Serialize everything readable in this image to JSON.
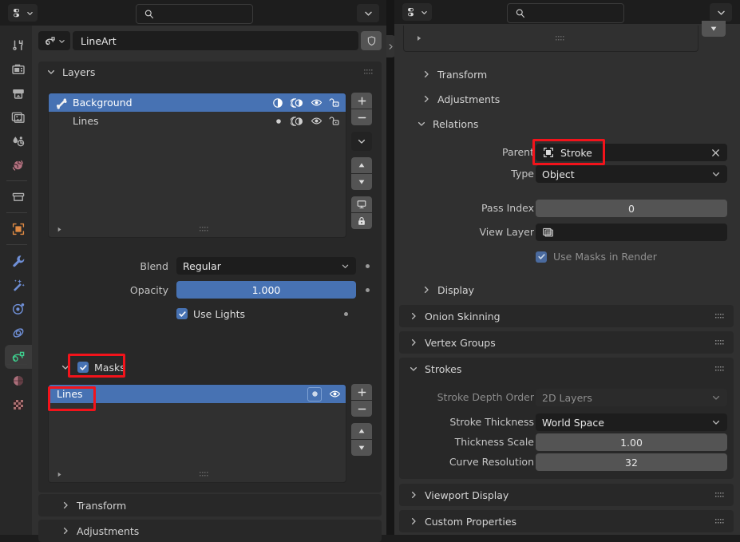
{
  "app": "blender-properties-editor",
  "left_editor": {
    "header": {
      "editor_type_icon": "properties-editor-icon",
      "search_placeholder": "",
      "search_icon": "search-icon",
      "overflow_icon": "chevron-down-icon"
    },
    "breadcrumb": {
      "datablock_icon": "grease-pencil-data-icon",
      "name": "LineArt",
      "shield_icon": "fake-user-shield-icon"
    },
    "layers_panel": {
      "title": "Layers",
      "expanded": true,
      "grip_icon": "drag-grip-icon",
      "rows": [
        {
          "name": "Background",
          "selected": true,
          "mask_icon": "layer-mask-icon",
          "onion_icon": "onion-skin-icon",
          "hide_icon": "eye-icon",
          "lock_icon": "unlocked-icon"
        },
        {
          "name": "Lines",
          "selected": false,
          "mask_icon": "dot-icon",
          "onion_icon": "onion-skin-icon",
          "hide_icon": "eye-icon",
          "lock_icon": "unlocked-icon"
        }
      ],
      "list_footer_expand_icon": "triangle-right-icon",
      "list_footer_grip_icon": "drag-grip-icon",
      "side_buttons": [
        {
          "name": "add-layer-button",
          "icon": "plus-icon"
        },
        {
          "name": "remove-layer-button",
          "icon": "minus-icon"
        },
        {
          "name": "layer-specials-menu-button",
          "icon": "chevron-down-icon"
        },
        {
          "name": "move-layer-up-button",
          "icon": "triangle-up-icon"
        },
        {
          "name": "move-layer-down-button",
          "icon": "triangle-down-icon"
        },
        {
          "name": "isolate-layer-button",
          "icon": "monitor-icon"
        },
        {
          "name": "lock-layer-button",
          "icon": "lock-icon"
        }
      ]
    },
    "properties": {
      "blend": {
        "label": "Blend",
        "value": "Regular",
        "animate_icon": "animate-dot-icon"
      },
      "opacity": {
        "label": "Opacity",
        "value": "1.000",
        "animate_icon": "animate-dot-icon"
      },
      "use_lights": {
        "label": "Use Lights",
        "checked": true,
        "animate_icon": "animate-dot-icon"
      }
    },
    "masks_panel": {
      "title": "Masks",
      "checked": true,
      "expanded": true,
      "highlighted": true,
      "rows": [
        {
          "name": "Lines",
          "selected": true,
          "highlighted": true,
          "invert_icon": "circle-filled-icon",
          "hide_icon": "eye-icon"
        }
      ],
      "list_footer_expand_icon": "triangle-right-icon",
      "list_footer_grip_icon": "drag-grip-icon",
      "side_buttons": [
        {
          "name": "add-mask-button",
          "icon": "plus-icon"
        },
        {
          "name": "remove-mask-button",
          "icon": "minus-icon"
        },
        {
          "name": "move-mask-up-button",
          "icon": "triangle-up-icon"
        },
        {
          "name": "move-mask-down-button",
          "icon": "triangle-down-icon"
        }
      ]
    },
    "bottom_panels": [
      {
        "title": "Transform",
        "expanded": false
      },
      {
        "title": "Adjustments",
        "expanded": false
      }
    ]
  },
  "tab_column": {
    "tabs": [
      {
        "name": "tool-tab",
        "icon": "tool-screwdriver-wrench-icon",
        "active": false
      },
      {
        "name": "render-tab",
        "icon": "camera-back-icon",
        "active": false
      },
      {
        "name": "output-tab",
        "icon": "printer-icon",
        "active": false
      },
      {
        "name": "view-layer-tab",
        "icon": "images-icon",
        "active": false
      },
      {
        "name": "scene-tab",
        "icon": "scene-cone-droplet-icon",
        "active": false
      },
      {
        "name": "world-tab",
        "icon": "world-globe-icon",
        "active": false
      },
      {
        "name": "collection-tab",
        "icon": "collection-box-icon",
        "active": false
      },
      {
        "name": "object-tab",
        "icon": "object-square-icon",
        "active": false
      },
      {
        "name": "modifiers-tab",
        "icon": "wrench-icon",
        "active": false
      },
      {
        "name": "effects-tab",
        "icon": "magic-wand-icon",
        "active": false
      },
      {
        "name": "particles-tab",
        "icon": "particles-icon",
        "active": false
      },
      {
        "name": "physics-tab",
        "icon": "physics-orbit-icon",
        "active": false
      },
      {
        "name": "object-data-tab",
        "icon": "grease-pencil-data-icon",
        "active": true
      },
      {
        "name": "material-tab",
        "icon": "material-sphere-icon",
        "active": false
      },
      {
        "name": "texture-tab",
        "icon": "texture-checker-icon",
        "active": false
      }
    ]
  },
  "right_editor": {
    "header": {
      "editor_type_icon": "properties-editor-icon",
      "search_placeholder": "",
      "search_icon": "search-icon",
      "overflow_icon": "chevron-down-icon"
    },
    "scroll_up_icon": "triangle-down-icon",
    "region_toggle_icon": "chevron-right-icon",
    "list_footer_expand_icon": "triangle-right-icon",
    "list_footer_grip_icon": "drag-grip-icon",
    "panels": [
      {
        "title": "Transform",
        "expanded": false,
        "sub": true
      },
      {
        "title": "Adjustments",
        "expanded": false,
        "sub": true
      },
      {
        "title": "Relations",
        "expanded": true,
        "sub": true
      }
    ],
    "relations": {
      "parent": {
        "label": "Parent",
        "value": "Stroke",
        "object_icon": "object-square-icon",
        "clear_icon": "x-icon",
        "highlighted": true
      },
      "type": {
        "label": "Type",
        "value": "Object"
      },
      "pass_index": {
        "label": "Pass Index",
        "value": "0"
      },
      "view_layer": {
        "label": "View Layer",
        "value": "",
        "icon": "images-icon"
      },
      "use_masks_in_render": {
        "label": "Use Masks in Render",
        "checked": true,
        "disabled": true
      }
    },
    "display_panel": {
      "title": "Display",
      "expanded": false,
      "sub": true
    },
    "onion_skinning_panel": {
      "title": "Onion Skinning",
      "expanded": false,
      "grip_icon": "drag-grip-icon"
    },
    "vertex_groups_panel": {
      "title": "Vertex Groups",
      "expanded": false,
      "grip_icon": "drag-grip-icon"
    },
    "strokes_panel": {
      "title": "Strokes",
      "expanded": true,
      "grip_icon": "drag-grip-icon",
      "fields": [
        {
          "label": "Stroke Depth Order",
          "value": "2D Layers",
          "kind": "dropdown",
          "disabled": true
        },
        {
          "label": "Stroke Thickness",
          "value": "World Space",
          "kind": "dropdown",
          "disabled": false
        },
        {
          "label": "Thickness Scale",
          "value": "1.00",
          "kind": "number",
          "disabled": false
        },
        {
          "label": "Curve Resolution",
          "value": "32",
          "kind": "number",
          "disabled": false
        }
      ]
    },
    "viewport_display_panel": {
      "title": "Viewport Display",
      "expanded": false,
      "grip_icon": "drag-grip-icon"
    },
    "custom_properties_panel": {
      "title": "Custom Properties",
      "expanded": false,
      "grip_icon": "drag-grip-icon"
    }
  },
  "colors": {
    "select_blue": "#4772b3",
    "highlight_red": "#f2131b",
    "editor_bg": "#303030",
    "panel_bg": "#282828",
    "field_dark": "#1d1d1d",
    "field_grey": "#545454"
  }
}
